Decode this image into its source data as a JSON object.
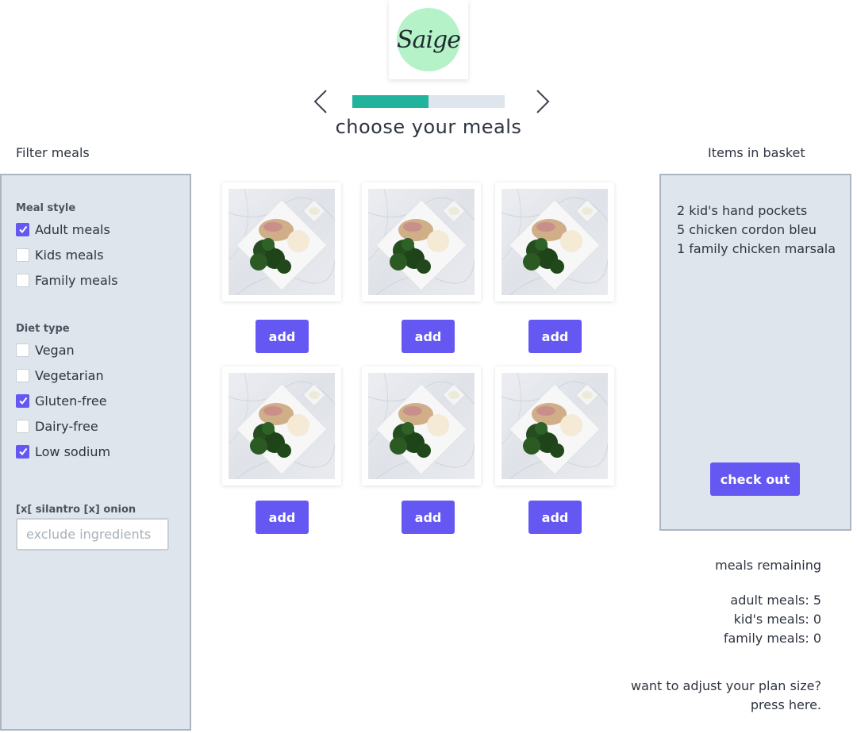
{
  "logo": {
    "text": "Saige",
    "color": "#b5f2c8"
  },
  "header": {
    "title": "choose your meals",
    "progress": 0.5
  },
  "filters": {
    "heading": "Filter meals",
    "meal_style": {
      "label": "Meal style",
      "options": [
        {
          "label": "Adult meals",
          "checked": true
        },
        {
          "label": "Kids meals",
          "checked": false
        },
        {
          "label": "Family meals",
          "checked": false
        }
      ]
    },
    "diet_type": {
      "label": "Diet type",
      "options": [
        {
          "label": "Vegan",
          "checked": false
        },
        {
          "label": "Vegetarian",
          "checked": false
        },
        {
          "label": "Gluten-free",
          "checked": true
        },
        {
          "label": "Dairy-free",
          "checked": false
        },
        {
          "label": "Low sodium",
          "checked": true
        }
      ]
    },
    "exclude": {
      "label": "[x[ silantro [x] onion",
      "placeholder": "exclude ingredients"
    }
  },
  "meals": {
    "add_label": "add",
    "items": [
      {
        "image": "plated-meal-photo"
      },
      {
        "image": "plated-meal-photo"
      },
      {
        "image": "plated-meal-photo"
      },
      {
        "image": "plated-meal-photo"
      },
      {
        "image": "plated-meal-photo"
      },
      {
        "image": "plated-meal-photo"
      }
    ]
  },
  "basket": {
    "heading": "Items in basket",
    "items": [
      "2 kid's hand pockets",
      "5 chicken cordon bleu",
      "1 family chicken marsala"
    ],
    "checkout_label": "check out"
  },
  "remaining": {
    "heading": "meals remaining",
    "adult": "adult meals: 5",
    "kids": "kid's meals: 0",
    "family": "family meals: 0"
  },
  "adjust": {
    "line1": "want to adjust your plan size?",
    "line2": "press here."
  },
  "colors": {
    "accent": "#6457f2",
    "progress": "#21b39c",
    "panel": "#dfe5ec",
    "panel_border": "#aab6c2"
  }
}
